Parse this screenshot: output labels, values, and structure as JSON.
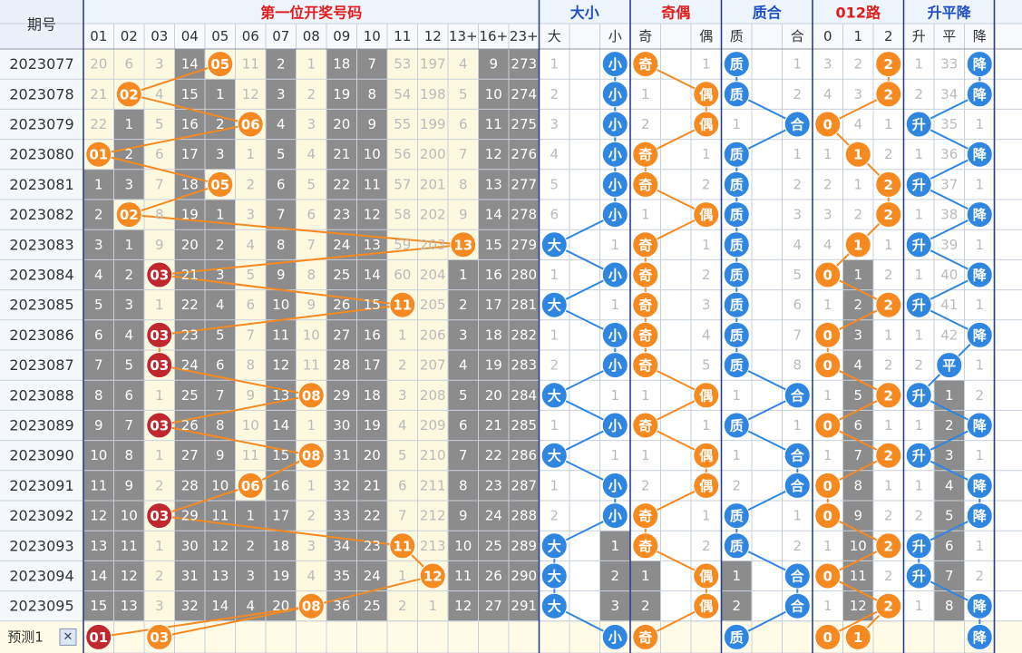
{
  "header": {
    "period_label": "期号",
    "group_labels": [
      "第一位开奖号码",
      "大小",
      "奇偶",
      "质合",
      "012路",
      "升平降"
    ],
    "column_labels": [
      "01",
      "02",
      "03",
      "04",
      "05",
      "06",
      "07",
      "08",
      "09",
      "10",
      "11",
      "12",
      "13+",
      "16+",
      "23+",
      "大",
      "",
      "小",
      "奇",
      "",
      "偶",
      "质",
      "",
      "合",
      "0",
      "1",
      "2",
      "升",
      "平",
      "降"
    ]
  },
  "colors": {
    "orange": "#f6891f",
    "red": "#c0282d",
    "blue": "#2f86e0",
    "title_red": "#e01d1d",
    "title_blue": "#1d4fc4",
    "gray_cell": "#8c8c8c",
    "pale_cell": "#fdf9df"
  },
  "chart_data": {
    "type": "table",
    "periods": [
      "2023077",
      "2023078",
      "2023079",
      "2023080",
      "2023081",
      "2023082",
      "2023083",
      "2023084",
      "2023085",
      "2023086",
      "2023087",
      "2023088",
      "2023089",
      "2023090",
      "2023091",
      "2023092",
      "2023093",
      "2023094",
      "2023095"
    ],
    "rows": [
      [
        "20",
        "6",
        "3",
        "14",
        "05",
        "11",
        "2",
        "1",
        "18",
        "7",
        "53",
        "197",
        "4",
        "9",
        "273",
        "1",
        "",
        "小",
        "奇",
        "",
        "1",
        "质",
        "",
        "1",
        "3",
        "2",
        "2",
        "1",
        "33",
        "降"
      ],
      [
        "21",
        "02",
        "4",
        "15",
        "1",
        "12",
        "3",
        "2",
        "19",
        "8",
        "54",
        "198",
        "5",
        "10",
        "274",
        "2",
        "",
        "小",
        "1",
        "",
        "偶",
        "质",
        "",
        "2",
        "4",
        "3",
        "2",
        "2",
        "34",
        "降"
      ],
      [
        "22",
        "1",
        "5",
        "16",
        "2",
        "06",
        "4",
        "3",
        "20",
        "9",
        "55",
        "199",
        "6",
        "11",
        "275",
        "3",
        "",
        "小",
        "2",
        "",
        "偶",
        "1",
        "",
        "合",
        "0",
        "4",
        "1",
        "升",
        "35",
        "1"
      ],
      [
        "01",
        "2",
        "6",
        "17",
        "3",
        "1",
        "5",
        "4",
        "21",
        "10",
        "56",
        "200",
        "7",
        "12",
        "276",
        "4",
        "",
        "小",
        "奇",
        "",
        "1",
        "质",
        "",
        "1",
        "1",
        "1",
        "2",
        "1",
        "36",
        "降"
      ],
      [
        "1",
        "3",
        "7",
        "18",
        "05",
        "2",
        "6",
        "5",
        "22",
        "11",
        "57",
        "201",
        "8",
        "13",
        "277",
        "5",
        "",
        "小",
        "奇",
        "",
        "2",
        "质",
        "",
        "2",
        "2",
        "1",
        "2",
        "升",
        "37",
        "1"
      ],
      [
        "2",
        "02",
        "8",
        "19",
        "1",
        "3",
        "7",
        "6",
        "23",
        "12",
        "58",
        "202",
        "9",
        "14",
        "278",
        "6",
        "",
        "小",
        "1",
        "",
        "偶",
        "质",
        "",
        "3",
        "3",
        "2",
        "2",
        "1",
        "38",
        "降"
      ],
      [
        "3",
        "1",
        "9",
        "20",
        "2",
        "4",
        "8",
        "7",
        "24",
        "13",
        "59",
        "203",
        "13",
        "15",
        "279",
        "大",
        "",
        "1",
        "奇",
        "",
        "1",
        "质",
        "",
        "4",
        "4",
        "1",
        "1",
        "升",
        "39",
        "1"
      ],
      [
        "4",
        "2",
        "03",
        "21",
        "3",
        "5",
        "9",
        "8",
        "25",
        "14",
        "60",
        "204",
        "1",
        "16",
        "280",
        "1",
        "",
        "小",
        "奇",
        "",
        "2",
        "质",
        "",
        "5",
        "0",
        "1",
        "2",
        "1",
        "40",
        "降"
      ],
      [
        "5",
        "3",
        "1",
        "22",
        "4",
        "6",
        "10",
        "9",
        "26",
        "15",
        "11",
        "205",
        "2",
        "17",
        "281",
        "大",
        "",
        "1",
        "奇",
        "",
        "3",
        "质",
        "",
        "6",
        "1",
        "2",
        "2",
        "升",
        "41",
        "1"
      ],
      [
        "6",
        "4",
        "03",
        "23",
        "5",
        "7",
        "11",
        "10",
        "27",
        "16",
        "1",
        "206",
        "3",
        "18",
        "282",
        "1",
        "",
        "小",
        "奇",
        "",
        "4",
        "质",
        "",
        "7",
        "0",
        "3",
        "1",
        "1",
        "42",
        "降"
      ],
      [
        "7",
        "5",
        "03",
        "24",
        "6",
        "8",
        "12",
        "11",
        "28",
        "17",
        "2",
        "207",
        "4",
        "19",
        "283",
        "2",
        "",
        "小",
        "奇",
        "",
        "5",
        "质",
        "",
        "8",
        "0",
        "4",
        "2",
        "2",
        "平",
        "1"
      ],
      [
        "8",
        "6",
        "1",
        "25",
        "7",
        "9",
        "13",
        "08",
        "29",
        "18",
        "3",
        "208",
        "5",
        "20",
        "284",
        "大",
        "",
        "1",
        "1",
        "",
        "偶",
        "1",
        "",
        "合",
        "1",
        "5",
        "2",
        "升",
        "1",
        "2"
      ],
      [
        "9",
        "7",
        "03",
        "26",
        "8",
        "10",
        "14",
        "1",
        "30",
        "19",
        "4",
        "209",
        "6",
        "21",
        "285",
        "1",
        "",
        "小",
        "奇",
        "",
        "1",
        "质",
        "",
        "1",
        "0",
        "6",
        "1",
        "1",
        "2",
        "降"
      ],
      [
        "10",
        "8",
        "1",
        "27",
        "9",
        "11",
        "15",
        "08",
        "31",
        "20",
        "5",
        "210",
        "7",
        "22",
        "286",
        "大",
        "",
        "1",
        "1",
        "",
        "偶",
        "1",
        "",
        "合",
        "1",
        "7",
        "2",
        "升",
        "3",
        "1"
      ],
      [
        "11",
        "9",
        "2",
        "28",
        "10",
        "06",
        "16",
        "1",
        "32",
        "21",
        "6",
        "211",
        "8",
        "23",
        "287",
        "1",
        "",
        "小",
        "2",
        "",
        "偶",
        "2",
        "",
        "合",
        "0",
        "8",
        "1",
        "1",
        "4",
        "降"
      ],
      [
        "12",
        "10",
        "03",
        "29",
        "11",
        "1",
        "17",
        "2",
        "33",
        "22",
        "7",
        "212",
        "9",
        "24",
        "288",
        "2",
        "",
        "小",
        "奇",
        "",
        "1",
        "质",
        "",
        "1",
        "0",
        "9",
        "2",
        "2",
        "5",
        "降"
      ],
      [
        "13",
        "11",
        "1",
        "30",
        "12",
        "2",
        "18",
        "3",
        "34",
        "23",
        "11",
        "213",
        "10",
        "25",
        "289",
        "大",
        "",
        "1",
        "奇",
        "",
        "2",
        "质",
        "",
        "2",
        "1",
        "10",
        "2",
        "升",
        "6",
        "1"
      ],
      [
        "14",
        "12",
        "2",
        "31",
        "13",
        "3",
        "19",
        "4",
        "35",
        "24",
        "1",
        "12",
        "11",
        "26",
        "290",
        "大",
        "",
        "2",
        "1",
        "",
        "偶",
        "1",
        "",
        "合",
        "0",
        "11",
        "2",
        "升",
        "7",
        "2"
      ],
      [
        "15",
        "13",
        "3",
        "32",
        "14",
        "4",
        "20",
        "08",
        "36",
        "25",
        "2",
        "1",
        "12",
        "27",
        "291",
        "大",
        "",
        "3",
        "2",
        "",
        "偶",
        "2",
        "",
        "合",
        "1",
        "12",
        "2",
        "1",
        "8",
        "降"
      ]
    ],
    "prediction": {
      "label": "预测1",
      "close": "✕",
      "numbers": [
        "01",
        "03"
      ],
      "size": "小",
      "odd_even": "奇",
      "prime": "质",
      "route_012": [
        "0",
        "1"
      ],
      "trend": "降"
    }
  }
}
